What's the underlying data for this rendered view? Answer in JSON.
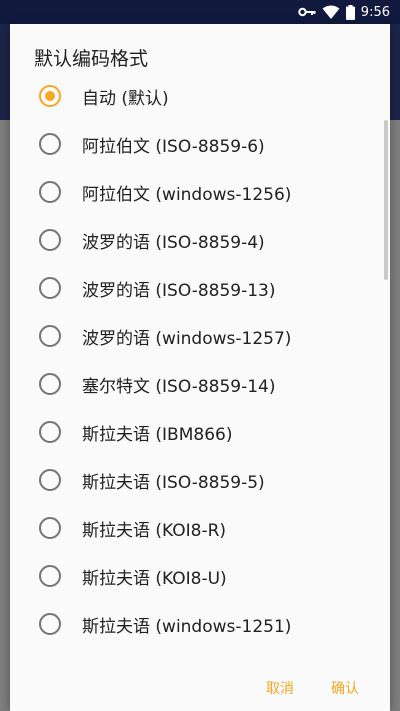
{
  "status_bar": {
    "time": "9:56",
    "icons": [
      "key-icon",
      "wifi-icon",
      "battery-icon"
    ]
  },
  "dialog": {
    "title": "默认编码格式",
    "options": [
      {
        "label": "自动 (默认)",
        "checked": true
      },
      {
        "label": "阿拉伯文 (ISO-8859-6)",
        "checked": false
      },
      {
        "label": "阿拉伯文 (windows-1256)",
        "checked": false
      },
      {
        "label": "波罗的语 (ISO-8859-4)",
        "checked": false
      },
      {
        "label": "波罗的语 (ISO-8859-13)",
        "checked": false
      },
      {
        "label": "波罗的语 (windows-1257)",
        "checked": false
      },
      {
        "label": "塞尔特文 (ISO-8859-14)",
        "checked": false
      },
      {
        "label": "斯拉夫语 (IBM866)",
        "checked": false
      },
      {
        "label": "斯拉夫语 (ISO-8859-5)",
        "checked": false
      },
      {
        "label": "斯拉夫语 (KOI8-R)",
        "checked": false
      },
      {
        "label": "斯拉夫语 (KOI8-U)",
        "checked": false
      },
      {
        "label": "斯拉夫语 (windows-1251)",
        "checked": false
      }
    ],
    "cancel_label": "取消",
    "ok_label": "确认"
  },
  "colors": {
    "accent": "#f5a623",
    "status_bar": "#111a3e",
    "dialog_bg": "#fafafa"
  }
}
